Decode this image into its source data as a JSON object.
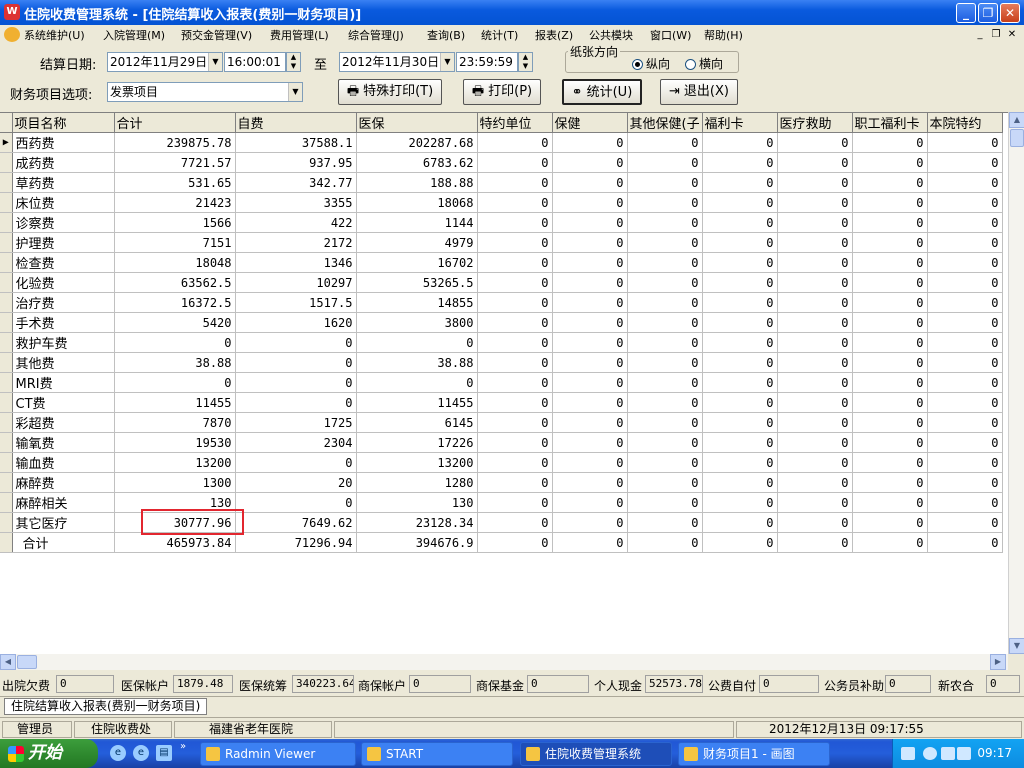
{
  "window": {
    "title": "住院收费管理系统 - [住院结算收入报表(费别一财务项目)]",
    "icon_label": "W"
  },
  "menu": [
    "系统维护(U)",
    "入院管理(M)",
    "预交金管理(V)",
    "费用管理(L)",
    "综合管理(J)",
    "查询(B)",
    "统计(T)",
    "报表(Z)",
    "公共模块",
    "窗口(W)",
    "帮助(H)"
  ],
  "toolbar": {
    "date_label": "结算日期:",
    "start_date": "2012年11月29日",
    "start_time": "16:00:01",
    "to_label": "至",
    "end_date": "2012年11月30日",
    "end_time": "23:59:59",
    "finance_label": "财务项目选项:",
    "finance_value": "发票项目",
    "paper_group_title": "纸张方向",
    "portrait_label": "纵向",
    "landscape_label": "横向",
    "special_print_label": "特殊打印(T)",
    "print_label": "打印(P)",
    "stats_label": "统计(U)",
    "exit_label": "退出(X)"
  },
  "grid": {
    "columns": [
      "项目名称",
      "合计",
      "自费",
      "医保",
      "特约单位",
      "保健",
      "其他保健(子",
      "福利卡",
      "医疗救助",
      "职工福利卡",
      "本院特约"
    ],
    "rows": [
      [
        "西药费",
        "239875.78",
        "37588.1",
        "202287.68",
        "0",
        "0",
        "0",
        "0",
        "0",
        "0",
        "0"
      ],
      [
        "成药费",
        "7721.57",
        "937.95",
        "6783.62",
        "0",
        "0",
        "0",
        "0",
        "0",
        "0",
        "0"
      ],
      [
        "草药费",
        "531.65",
        "342.77",
        "188.88",
        "0",
        "0",
        "0",
        "0",
        "0",
        "0",
        "0"
      ],
      [
        "床位费",
        "21423",
        "3355",
        "18068",
        "0",
        "0",
        "0",
        "0",
        "0",
        "0",
        "0"
      ],
      [
        "诊察费",
        "1566",
        "422",
        "1144",
        "0",
        "0",
        "0",
        "0",
        "0",
        "0",
        "0"
      ],
      [
        "护理费",
        "7151",
        "2172",
        "4979",
        "0",
        "0",
        "0",
        "0",
        "0",
        "0",
        "0"
      ],
      [
        "检查费",
        "18048",
        "1346",
        "16702",
        "0",
        "0",
        "0",
        "0",
        "0",
        "0",
        "0"
      ],
      [
        "化验费",
        "63562.5",
        "10297",
        "53265.5",
        "0",
        "0",
        "0",
        "0",
        "0",
        "0",
        "0"
      ],
      [
        "治疗费",
        "16372.5",
        "1517.5",
        "14855",
        "0",
        "0",
        "0",
        "0",
        "0",
        "0",
        "0"
      ],
      [
        "手术费",
        "5420",
        "1620",
        "3800",
        "0",
        "0",
        "0",
        "0",
        "0",
        "0",
        "0"
      ],
      [
        "救护车费",
        "0",
        "0",
        "0",
        "0",
        "0",
        "0",
        "0",
        "0",
        "0",
        "0"
      ],
      [
        "其他费",
        "38.88",
        "0",
        "38.88",
        "0",
        "0",
        "0",
        "0",
        "0",
        "0",
        "0"
      ],
      [
        "MRI费",
        "0",
        "0",
        "0",
        "0",
        "0",
        "0",
        "0",
        "0",
        "0",
        "0"
      ],
      [
        "CT费",
        "11455",
        "0",
        "11455",
        "0",
        "0",
        "0",
        "0",
        "0",
        "0",
        "0"
      ],
      [
        "彩超费",
        "7870",
        "1725",
        "6145",
        "0",
        "0",
        "0",
        "0",
        "0",
        "0",
        "0"
      ],
      [
        "输氧费",
        "19530",
        "2304",
        "17226",
        "0",
        "0",
        "0",
        "0",
        "0",
        "0",
        "0"
      ],
      [
        "输血费",
        "13200",
        "0",
        "13200",
        "0",
        "0",
        "0",
        "0",
        "0",
        "0",
        "0"
      ],
      [
        "麻醉费",
        "1300",
        "20",
        "1280",
        "0",
        "0",
        "0",
        "0",
        "0",
        "0",
        "0"
      ],
      [
        "麻醉相关",
        "130",
        "0",
        "130",
        "0",
        "0",
        "0",
        "0",
        "0",
        "0",
        "0"
      ],
      [
        "其它医疗",
        "30777.96",
        "7649.62",
        "23128.34",
        "0",
        "0",
        "0",
        "0",
        "0",
        "0",
        "0"
      ],
      [
        "合计",
        "465973.84",
        "71296.94",
        "394676.9",
        "0",
        "0",
        "0",
        "0",
        "0",
        "0",
        "0"
      ]
    ],
    "highlight_color": "#e2262f"
  },
  "summary": [
    {
      "label": "出院欠费",
      "value": "0"
    },
    {
      "label": "医保帐户",
      "value": "1879.48"
    },
    {
      "label": "医保统筹",
      "value": "340223.64"
    },
    {
      "label": "商保帐户",
      "value": "0"
    },
    {
      "label": "商保基金",
      "value": "0"
    },
    {
      "label": "个人现金",
      "value": "52573.78"
    },
    {
      "label": "公费自付",
      "value": "0"
    },
    {
      "label": "公务员补助",
      "value": "0"
    },
    {
      "label": "新农合",
      "value": "0"
    }
  ],
  "tab": {
    "label": "住院结算收入报表(费别一财务项目)"
  },
  "status": {
    "role": "管理员",
    "department": "住院收费处",
    "hospital": "福建省老年医院",
    "datetime": "2012年12月13日 09:17:55"
  },
  "taskbar": {
    "start_label": "开始",
    "tasks": [
      "Radmin Viewer",
      "START",
      "住院收费管理系统",
      "财务项目1 - 画图"
    ],
    "clock": "09:17"
  }
}
